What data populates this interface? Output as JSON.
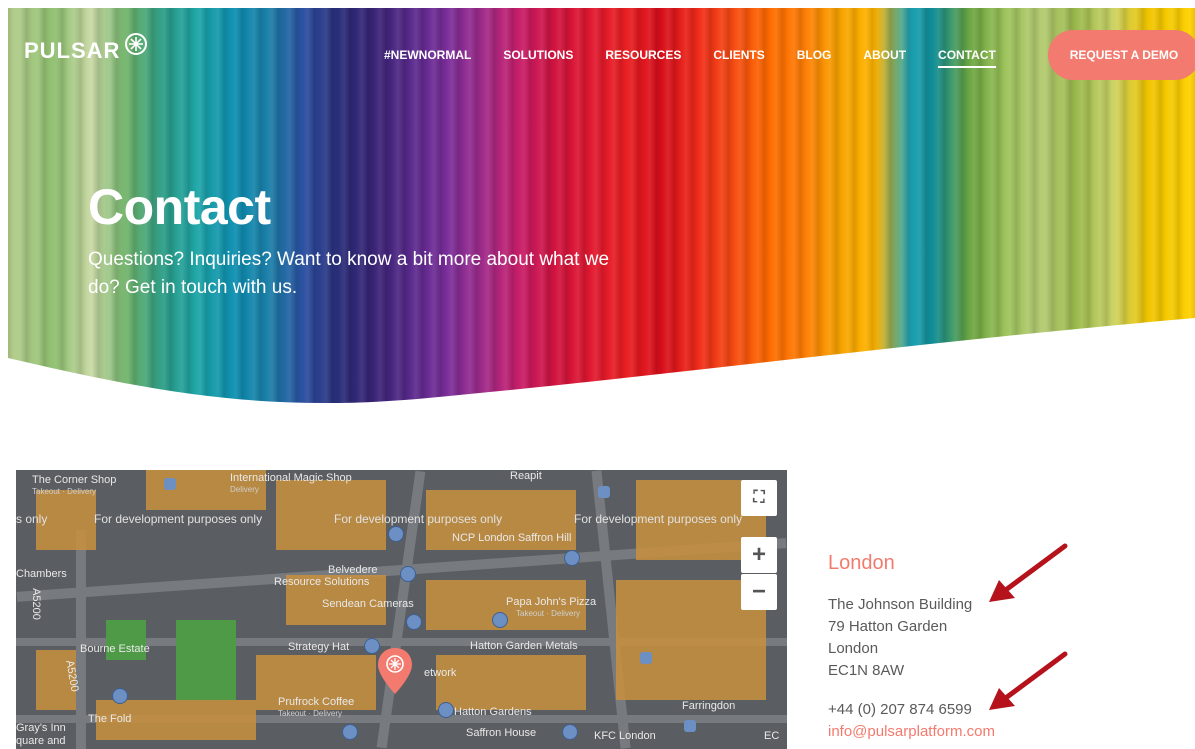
{
  "brand": {
    "name": "PULSAR"
  },
  "nav": {
    "items": [
      "#NEWNORMAL",
      "SOLUTIONS",
      "RESOURCES",
      "CLIENTS",
      "BLOG",
      "ABOUT",
      "CONTACT"
    ],
    "active": "CONTACT",
    "cta": "REQUEST A DEMO"
  },
  "hero": {
    "title": "Contact",
    "subtitle": "Questions? Inquiries? Want to know a bit more about what we do? Get in touch with us."
  },
  "map": {
    "dev_notice": [
      "s only",
      "For development purposes only",
      "For development purposes only",
      "For development purposes only"
    ],
    "labels": {
      "corner_shop": "The Corner Shop",
      "corner_shop_sub": "Takeout · Delivery",
      "magic_shop": "International Magic Shop",
      "magic_shop_sub": "Delivery",
      "reapit": "Reapit",
      "ncp": "NCP London Saffron Hill",
      "chambers": "Chambers",
      "belvedere": "Belvedere",
      "resource": "Resource Solutions",
      "sendean": "Sendean Cameras",
      "papa": "Papa John's Pizza",
      "papa_sub": "Takeout · Delivery",
      "bourne": "Bourne Estate",
      "strategy": "Strategy Hat",
      "hatton_metals": "Hatton Garden Metals",
      "network": "etwork",
      "prufrock": "Prufrock Coffee",
      "prufrock_sub": "Takeout · Delivery",
      "hatton_gardens": "Hatton Gardens",
      "fold": "The Fold",
      "grays": "Gray's Inn",
      "grays2": "quare and",
      "saffron": "Saffron House",
      "kfc": "KFC London",
      "farringdon": "Farringdon",
      "a5200": "A5200",
      "a5200b": "A5200",
      "ec": "EC"
    },
    "controls": {
      "fullscreen": "⛶",
      "zoom_in": "+",
      "zoom_out": "−"
    }
  },
  "office": {
    "city": "London",
    "address": [
      "The Johnson Building",
      "79 Hatton Garden",
      "London",
      "EC1N 8AW"
    ],
    "phone": "+44 (0) 207 874 6599",
    "email": "info@pulsarplatform.com"
  },
  "colors": {
    "accent": "#f37a6e",
    "arrow": "#b5121b"
  }
}
